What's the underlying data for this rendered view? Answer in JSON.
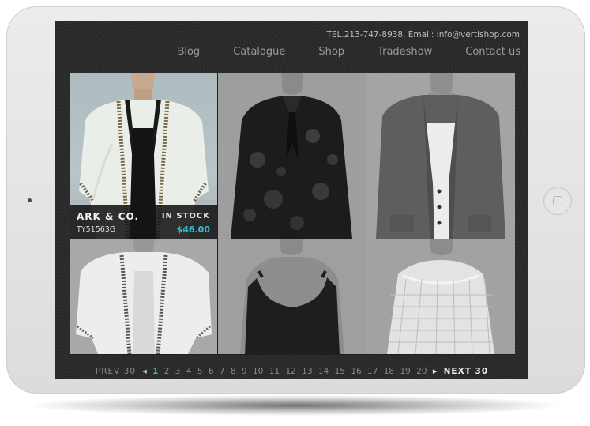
{
  "header": {
    "contact": "TEL.213-747-8938, Email: info@vertishop.com",
    "nav": [
      "Blog",
      "Catalogue",
      "Shop",
      "Tradeshow",
      "Contact us"
    ]
  },
  "product": {
    "brand": "ARK & CO.",
    "stock": "IN STOCK",
    "sku": "TY51563G",
    "price": "$46.00"
  },
  "grid": {
    "items": [
      "cardigan-beaded-mint",
      "floral-sheer-blouse",
      "grey-knit-cardigan",
      "white-beaded-kimono",
      "black-tank-top",
      "white-open-knit-sweater"
    ]
  },
  "pagination": {
    "prev": "PREV 30",
    "next": "NEXT 30",
    "current": "1",
    "pages": [
      "2",
      "3",
      "4",
      "5",
      "6",
      "7",
      "8",
      "9",
      "10",
      "11",
      "12",
      "13",
      "14",
      "15",
      "16",
      "17",
      "18",
      "19",
      "20"
    ]
  },
  "colors": {
    "accent": "#2fc0d8",
    "screen": "#2c2c2c"
  }
}
